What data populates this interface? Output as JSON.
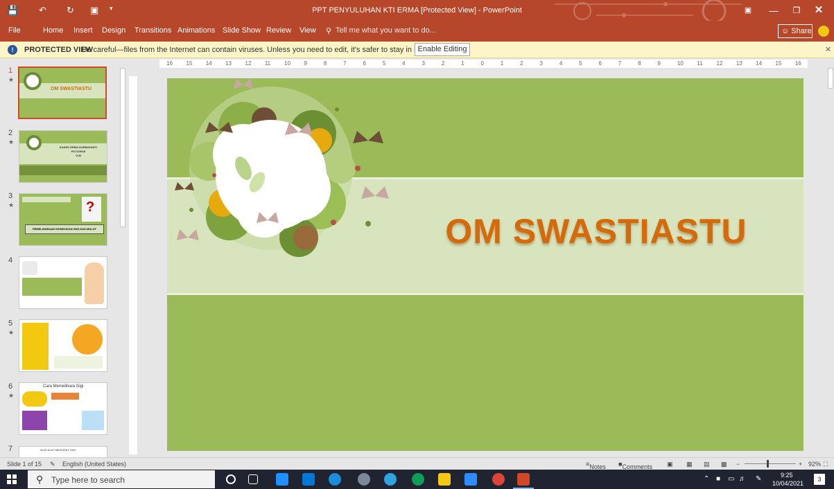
{
  "window": {
    "title": "PPT PENYULUHAN KTI ERMA [Protected View] - PowerPoint"
  },
  "ribbon": {
    "tabs": [
      "File",
      "Home",
      "Insert",
      "Design",
      "Transitions",
      "Animations",
      "Slide Show",
      "Review",
      "View"
    ],
    "tell_me": "Tell me what you want to do...",
    "share": "Share"
  },
  "protected_view": {
    "label": "PROTECTED VIEW",
    "message": "Be careful—files from the Internet can contain viruses. Unless you need to edit, it's safer to stay in Protected View.",
    "button": "Enable Editing"
  },
  "thumbnails": {
    "numbers": [
      "1",
      "2",
      "3",
      "4",
      "5",
      "6",
      "7"
    ],
    "slide1_title": "OM SWASTIASTU",
    "slide2_lines": [
      "KADEK ERMA DARMAYANTI",
      "P07125018",
      "VI.B"
    ],
    "slide3_caption": "PEMELIHARAAN KESEHATAN GIGI DAN MULUT",
    "slide6_title": "Cara Memelihara Gigi",
    "slide7_title": "ALAT-ALAT MENYIKAT GIGI"
  },
  "ruler": {
    "labels": [
      "16",
      "15",
      "14",
      "13",
      "12",
      "11",
      "10",
      "9",
      "8",
      "7",
      "6",
      "5",
      "4",
      "3",
      "2",
      "1",
      "0",
      "1",
      "2",
      "3",
      "4",
      "5",
      "6",
      "7",
      "8",
      "9",
      "10",
      "11",
      "12",
      "13",
      "14",
      "15",
      "16"
    ]
  },
  "slide": {
    "title": "OM SWASTIASTU"
  },
  "status": {
    "slide_count": "Slide 1 of 15",
    "language": "English (United States)",
    "notes": "Notes",
    "comments": "Comments",
    "zoom": "92%"
  },
  "taskbar": {
    "search_placeholder": "Type here to search",
    "time": "9:25",
    "date": "10/04/2021",
    "notifications": "3"
  },
  "colors": {
    "ribbon": "#b7472a",
    "slide_bg": "#9bbb59",
    "slide_band": "#d7e4bd",
    "title_orange": "#d46a0a"
  }
}
